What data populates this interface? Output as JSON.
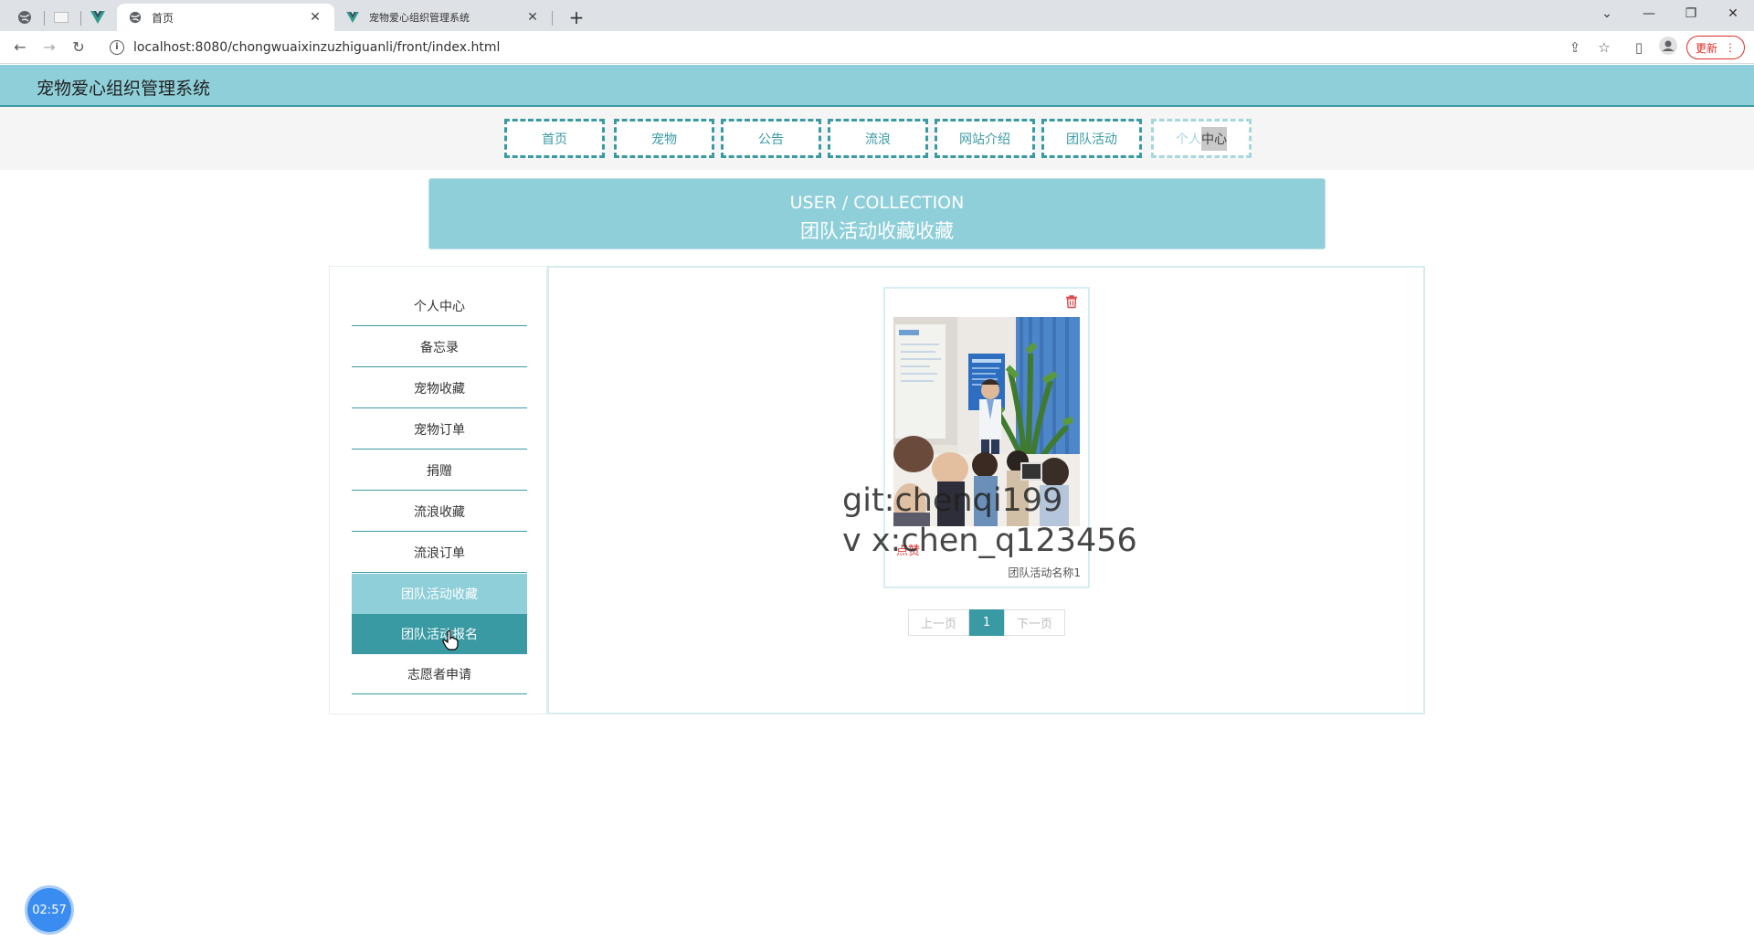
{
  "browser": {
    "tabs": [
      {
        "title": "首页",
        "active": true
      },
      {
        "title": "宠物爱心组织管理系统",
        "active": false
      }
    ],
    "url": "localhost:8080/chongwuaixinzuzhiguanli/front/index.html",
    "update_label": "更新"
  },
  "site": {
    "title": "宠物爱心组织管理系统",
    "nav": [
      "首页",
      "宠物",
      "公告",
      "流浪",
      "网站介绍",
      "团队活动"
    ],
    "nav_last": {
      "part1": "个人",
      "part2": "中心"
    }
  },
  "banner": {
    "en": "USER / COLLECTION",
    "zh": "团队活动收藏收藏"
  },
  "sidebar": {
    "items": [
      "个人中心",
      "备忘录",
      "宠物收藏",
      "宠物订单",
      "捐赠",
      "流浪收藏",
      "流浪订单",
      "团队活动收藏",
      "团队活动报名",
      "志愿者申请"
    ],
    "selected": "团队活动收藏",
    "hovered": "团队活动报名"
  },
  "card": {
    "like_label": "点赞",
    "name": "团队活动名称1"
  },
  "watermark": {
    "line1": "git:chenqi199",
    "line2": "v x:chen_q123456"
  },
  "pager": {
    "prev": "上一页",
    "current": "1",
    "next": "下一页"
  },
  "timer": "02:57",
  "colors": {
    "accent": "#3a9aa3",
    "accent_light": "#8ecfd9"
  }
}
